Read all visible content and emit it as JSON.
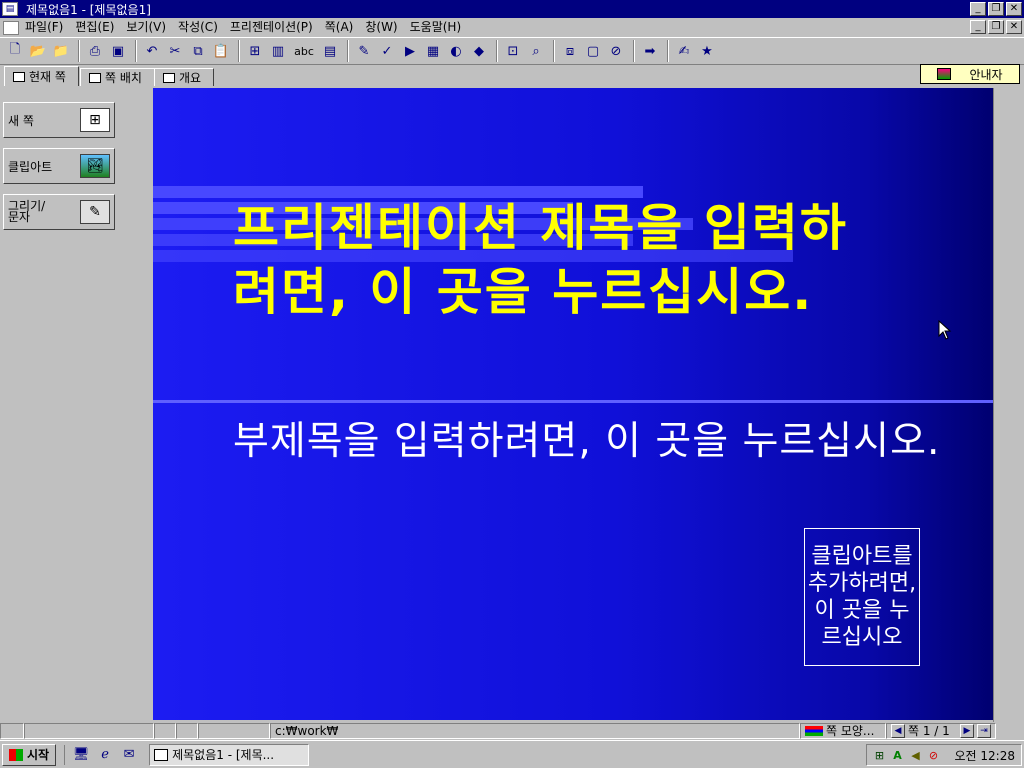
{
  "window": {
    "title": "제목없음1 - [제목없음1]",
    "buttons": {
      "minimize": "_",
      "restore": "❐",
      "close": "✕"
    }
  },
  "menubar": {
    "items": [
      "파일(F)",
      "편집(E)",
      "보기(V)",
      "작성(C)",
      "프리젠테이션(P)",
      "쪽(A)",
      "창(W)",
      "도움말(H)"
    ]
  },
  "toolbar": {
    "groups": [
      [
        "new-doc-icon",
        "open-icon",
        "open-folder-icon"
      ],
      [
        "print-icon",
        "preview-icon"
      ],
      [
        "undo-icon",
        "cut-icon",
        "copy-icon",
        "paste-icon"
      ],
      [
        "org-chart-icon",
        "bar-chart-icon",
        "text-abc-icon",
        "table-icon"
      ],
      [
        "line-style-icon",
        "spell-icon",
        "slide-show-icon",
        "template-icon",
        "color-icon",
        "shape-icon"
      ],
      [
        "zoom-page-icon",
        "magnifier-icon"
      ],
      [
        "arrange-icon",
        "frame-icon",
        "no-fill-icon"
      ],
      [
        "arrow-right-icon"
      ],
      [
        "draw-tool-icon",
        "star-icon"
      ]
    ],
    "text_button": "abc"
  },
  "tabs": [
    {
      "label": "현재 쪽"
    },
    {
      "label": "쪽 배치"
    },
    {
      "label": "개요"
    }
  ],
  "guide": {
    "label": "안내자"
  },
  "sidebar": {
    "buttons": [
      {
        "label": "새 쪽",
        "icon": "new-slide-icon"
      },
      {
        "label": "클립아트",
        "icon": "clipart-icon"
      },
      {
        "label": "그리기/\n문자",
        "icon": "draw-text-icon"
      }
    ]
  },
  "slide": {
    "title": "프리젠테이션 제목을 입력하려면, 이 곳을 누르십시오.",
    "subtitle": "부제목을 입력하려면, 이 곳을 누르십시오.",
    "clipart_placeholder": "클립아트를 추가하려면, 이 곳을 누르십시오",
    "colors": {
      "background": "#1010d8",
      "title": "#ffff00",
      "subtitle": "#ffffff",
      "stripe": "#4848ff"
    }
  },
  "statusbar": {
    "path": "c:₩work₩",
    "layout_label": "쪽 모양...",
    "page": "쪽 1 / 1"
  },
  "taskbar": {
    "start_label": "시작",
    "task_label": "제목없음1 - [제목...",
    "clock": "오전 12:28",
    "quick_icons": [
      "desktop-icon",
      "ie-icon",
      "outlook-icon"
    ],
    "tray_icons": [
      "network-icon",
      "ime-icon",
      "volume-icon",
      "block-icon"
    ]
  }
}
